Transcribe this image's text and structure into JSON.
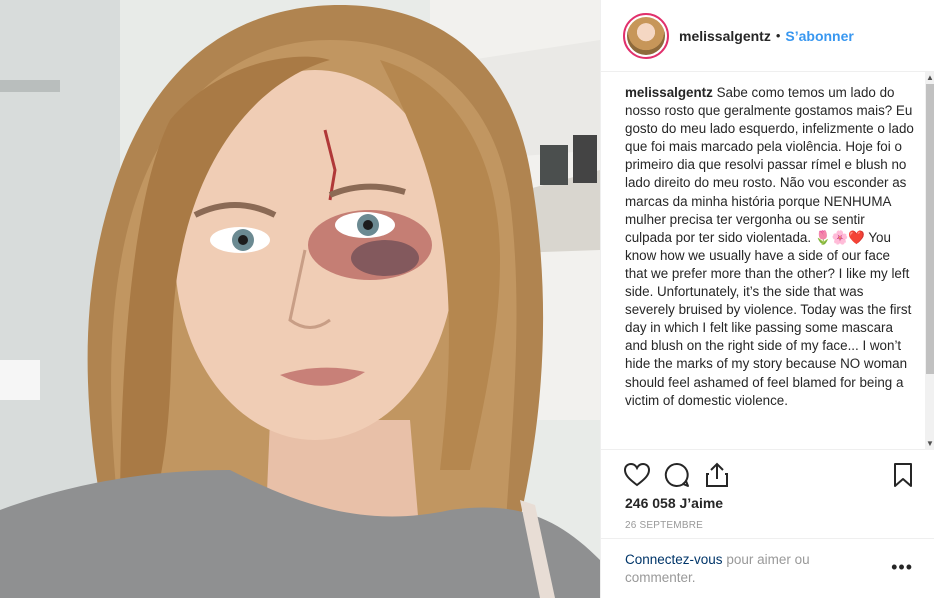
{
  "post": {
    "username": "melissalgentz",
    "separator": "•",
    "follow_label": "S’abonner",
    "caption_username": "melissalgentz",
    "caption_text": "Sabe como temos um lado do nosso rosto que geralmente gostamos mais? Eu gosto do meu lado esquerdo, infelizmente o lado que foi mais marcado pela violência. Hoje foi o primeiro dia que resolvi passar rímel e blush no lado direito do meu rosto. Não vou esconder as marcas da minha história porque NENHUMA mulher precisa ter vergonha ou se sentir culpada por ter sido violentada. 🌷🌸❤️ You know how we usually have a side of our face that we prefer more than the other? I like my left side. Unfortunately, it’s the side that was severely bruised by violence. Today was the first day in which I felt like passing some mascara and blush on the right side of my face... I won’t hide the marks of my story because NO woman should feel ashamed of feel blamed for being a victim of domestic violence.",
    "likes": "246 058 J’aime",
    "date": "26 SEPTEMBRE",
    "login_link": "Connectez-vous",
    "login_text": " pour aimer ou commenter.",
    "more_label": "•••"
  },
  "icons": {
    "like": "heart-icon",
    "comment": "comment-icon",
    "share": "share-icon",
    "save": "bookmark-icon",
    "more": "more-options-icon"
  },
  "colors": {
    "follow": "#3897f0",
    "avatar_ring": "#e1306c",
    "link": "#003569",
    "muted": "#999999"
  }
}
